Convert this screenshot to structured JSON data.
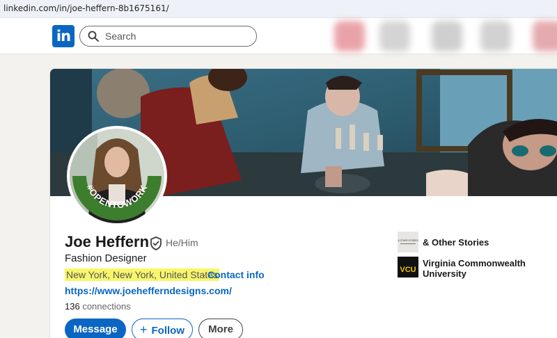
{
  "browser": {
    "url": "linkedin.com/in/joe-heffern-8b1675161/"
  },
  "nav": {
    "logo": "in",
    "search_placeholder": "Search"
  },
  "profile": {
    "name": "Joe Heffern",
    "pronouns": "He/Him",
    "headline": "Fashion Designer",
    "location": "New York, New York, United States",
    "separator": "·",
    "contact_info": "Contact info",
    "website": "https://www.joehefferndesigns.com/",
    "connections_count": "136",
    "connections_label": "connections",
    "open_to_work_badge": "#OPENTOWORK"
  },
  "actions": {
    "message": "Message",
    "follow_plus": "+",
    "follow": "Follow",
    "more": "More"
  },
  "experience": [
    {
      "name": "& Other Stories",
      "logo_text": "& OTHER STORIES"
    },
    {
      "name": "Virginia Commonwealth University",
      "logo_text": "VCU"
    }
  ],
  "colors": {
    "brand": "#0a66c2",
    "open_to_work": "#3d7d2e",
    "highlight": "#f8f66a"
  }
}
